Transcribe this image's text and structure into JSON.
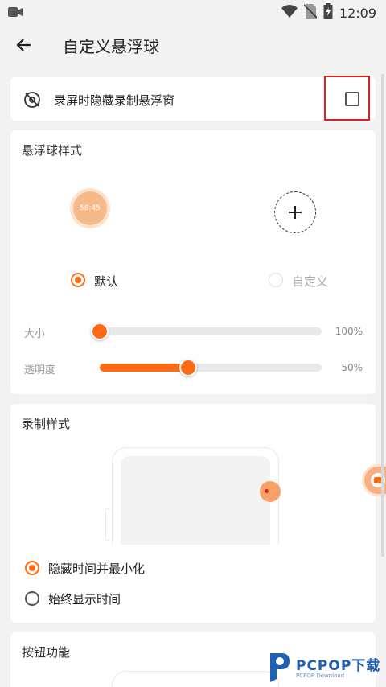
{
  "status_bar": {
    "time": "12:09",
    "icons": [
      "video-camera-icon",
      "wifi-icon",
      "no-sim-icon",
      "battery-charging-icon"
    ]
  },
  "app_bar": {
    "title": "自定义悬浮球",
    "back_icon": "arrow-left-icon"
  },
  "hide_row": {
    "label": "录屏时隐藏录制悬浮窗",
    "checked": false,
    "icon": "eye-off-icon"
  },
  "ball_style": {
    "title": "悬浮球样式",
    "preview_time": "58:45",
    "options": [
      {
        "label": "默认",
        "selected": true
      },
      {
        "label": "自定义",
        "selected": false
      }
    ],
    "sliders": [
      {
        "label": "大小",
        "value": 0,
        "display": "100%"
      },
      {
        "label": "透明度",
        "value": 40,
        "display": "50%"
      }
    ]
  },
  "record_style": {
    "title": "录制样式",
    "options": [
      {
        "label": "隐藏时间并最小化",
        "selected": true
      },
      {
        "label": "始终显示时间",
        "selected": false
      }
    ]
  },
  "button_func": {
    "title": "按钮功能"
  },
  "watermark": {
    "main": "PCPOP下载",
    "sub": "PCPOP Download"
  },
  "colors": {
    "accent": "#ff6a17",
    "highlight": "#e02020",
    "background": "#f2f2f2"
  }
}
